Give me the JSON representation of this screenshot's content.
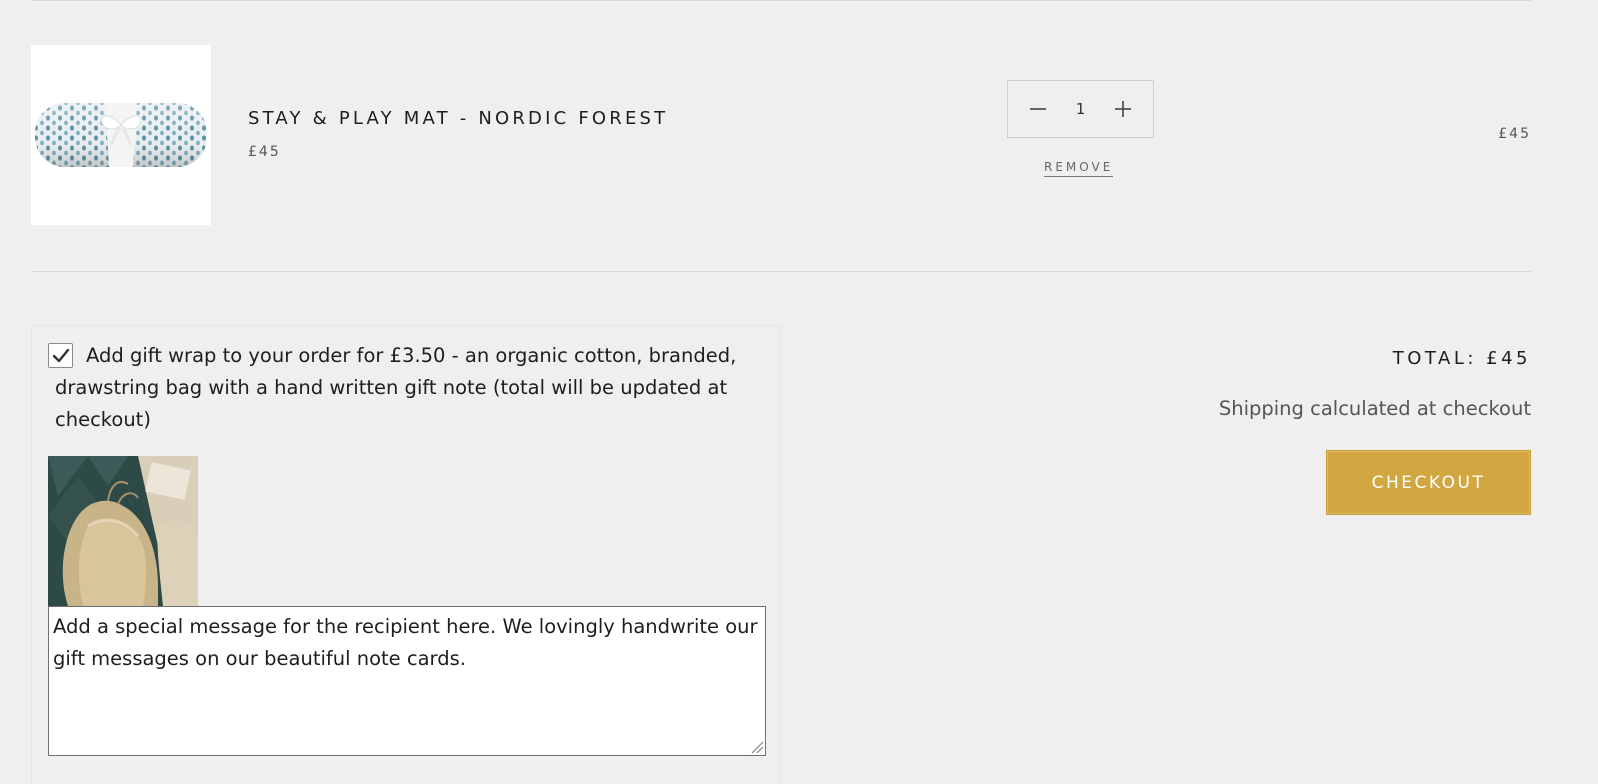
{
  "cart_item": {
    "title": "STAY & PLAY MAT - NORDIC FOREST",
    "price": "£45",
    "quantity": "1",
    "remove_label": "REMOVE",
    "line_total": "£45",
    "image_icon": "rolled-play-mat-image"
  },
  "gift_wrap": {
    "checked": true,
    "label": "Add gift wrap to your order for £3.50 - an organic cotton, branded, drawstring bag with a hand written gift note (total will be updated at checkout)",
    "image_icon": "gift-bag-image",
    "message": "Add a special message for the recipient here. We lovingly handwrite our gift messages on our beautiful note cards."
  },
  "summary": {
    "total": "TOTAL: £45",
    "shipping_note": "Shipping calculated at checkout",
    "checkout_label": "CHECKOUT"
  },
  "colors": {
    "background": "#efefef",
    "accent": "#d2a742",
    "text": "#1e1e1e"
  }
}
